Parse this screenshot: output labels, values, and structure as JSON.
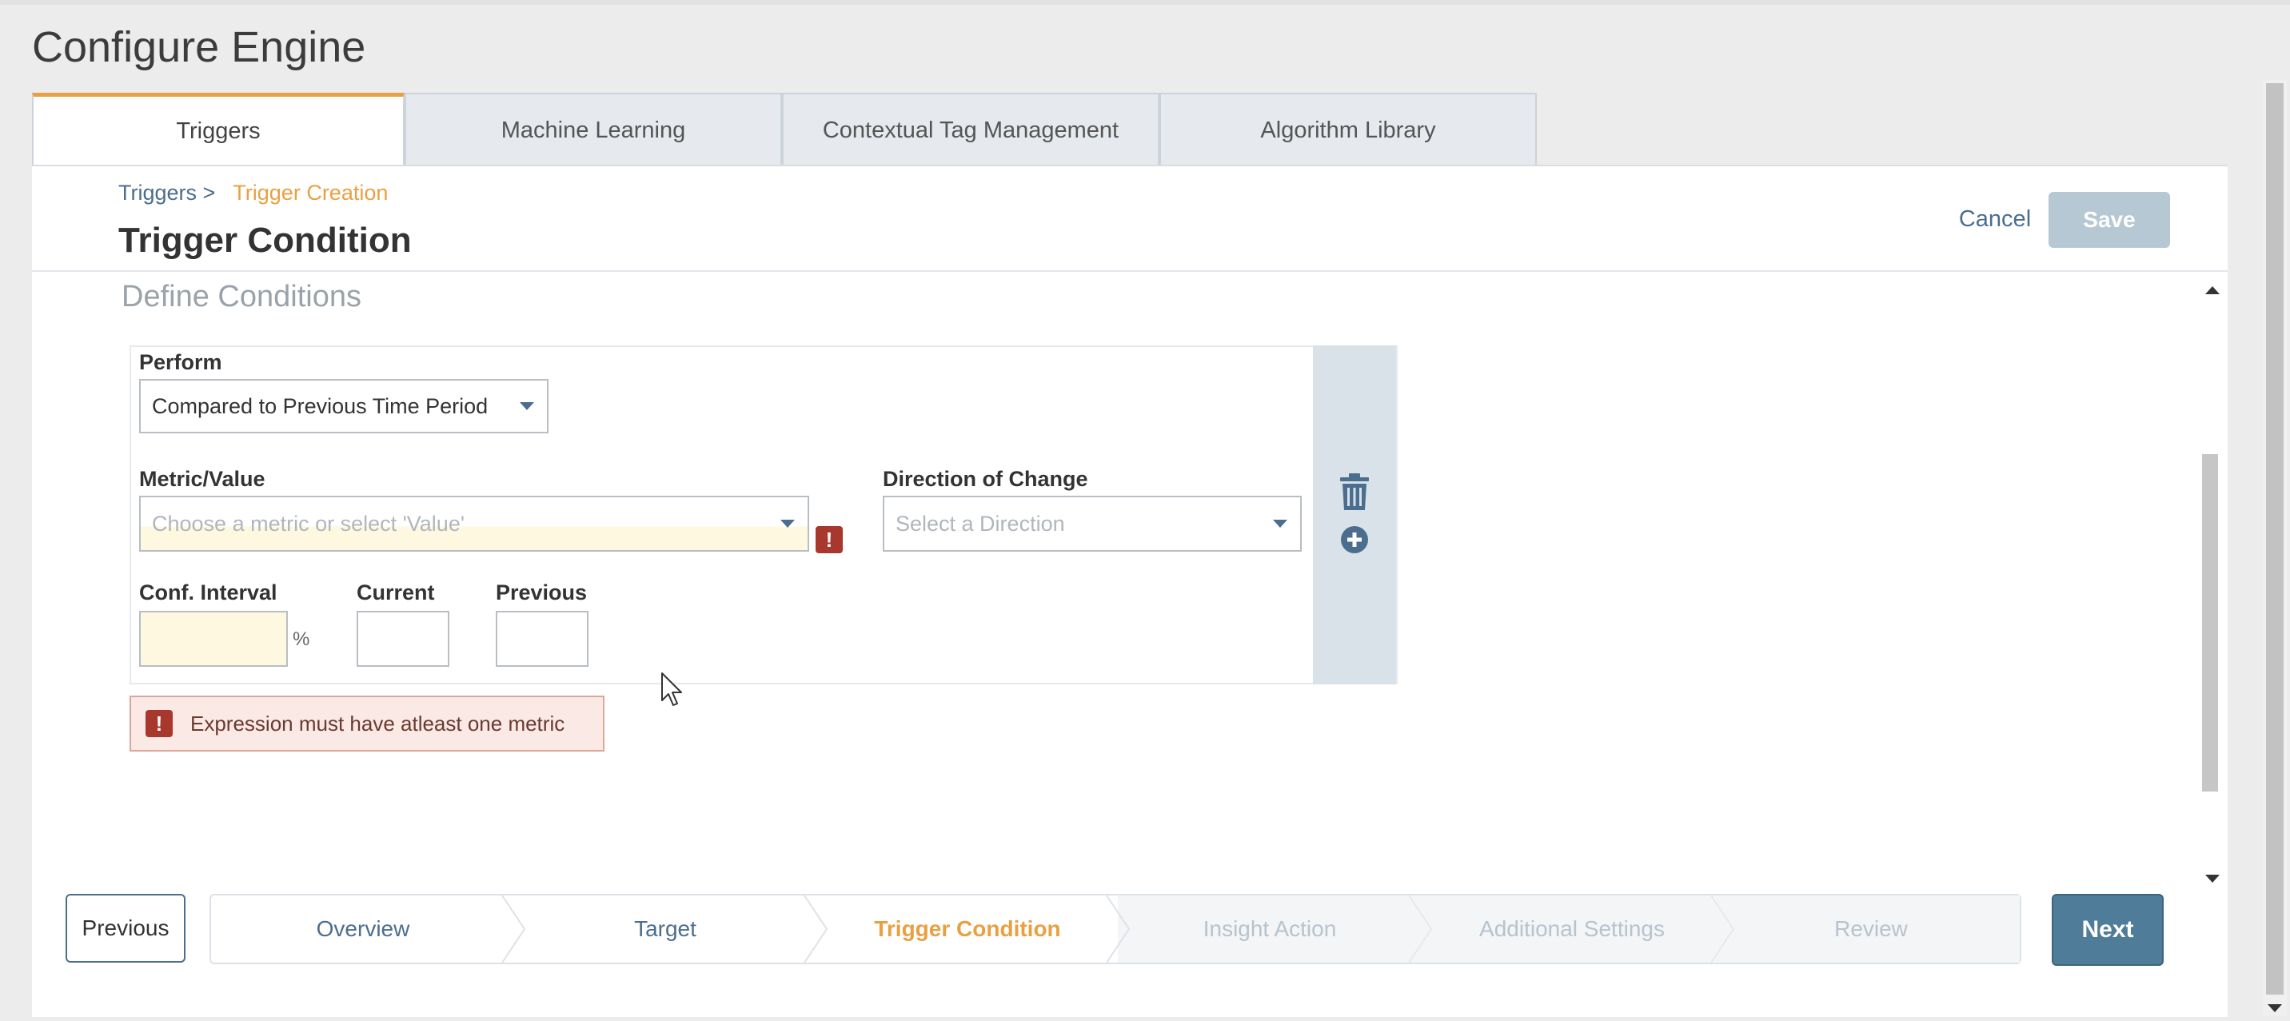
{
  "page": {
    "title": "Configure Engine"
  },
  "tabs": [
    {
      "label": "Triggers",
      "active": true
    },
    {
      "label": "Machine Learning",
      "active": false
    },
    {
      "label": "Contextual Tag Management",
      "active": false
    },
    {
      "label": "Algorithm Library",
      "active": false
    }
  ],
  "breadcrumb": {
    "parent": "Triggers >",
    "current": "Trigger Creation"
  },
  "header": {
    "title": "Trigger Condition",
    "cancel_label": "Cancel",
    "save_label": "Save"
  },
  "section": {
    "title": "Define Conditions"
  },
  "condition": {
    "perform_label": "Perform",
    "perform_value": "Compared to Previous Time Period",
    "metric_label": "Metric/Value",
    "metric_placeholder": "Choose a metric or select 'Value'",
    "direction_label": "Direction of Change",
    "direction_placeholder": "Select a Direction",
    "conf_label": "Conf. Interval",
    "conf_unit": "%",
    "current_label": "Current",
    "previous_label": "Previous"
  },
  "error": {
    "icon_text": "!",
    "message": "Expression must have atleast one metric"
  },
  "icons": {
    "delete": "trash-icon",
    "add": "plus-circle-icon",
    "error": "exclamation-icon"
  },
  "wizard": {
    "previous_label": "Previous",
    "next_label": "Next",
    "steps": [
      {
        "label": "Overview",
        "state": "done"
      },
      {
        "label": "Target",
        "state": "done"
      },
      {
        "label": "Trigger Condition",
        "state": "active"
      },
      {
        "label": "Insight Action",
        "state": "todo"
      },
      {
        "label": "Additional Settings",
        "state": "todo"
      },
      {
        "label": "Review",
        "state": "todo"
      }
    ]
  },
  "colors": {
    "accent": "#e9a043",
    "primary": "#4f7c98",
    "error": "#a8382e",
    "link": "#4b6e8e"
  }
}
